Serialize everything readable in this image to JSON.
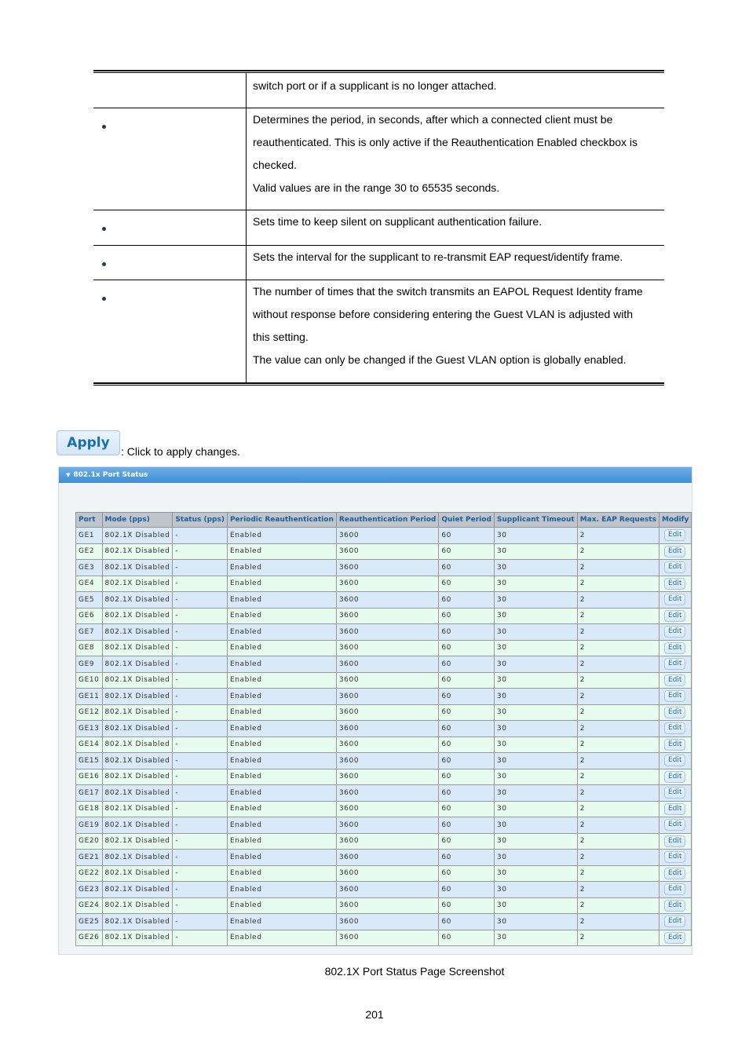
{
  "description_table": {
    "rows": [
      {
        "has_bullet": false,
        "lines": [
          "switch port or if a supplicant is no longer attached."
        ]
      },
      {
        "has_bullet": true,
        "lines": [
          "Determines the period, in seconds, after which a connected client must be",
          "reauthenticated. This is only active if the Reauthentication Enabled checkbox is",
          "checked.",
          "Valid values are in the range 30 to 65535 seconds."
        ]
      },
      {
        "has_bullet": true,
        "lines": [
          "Sets time to keep silent on supplicant authentication failure."
        ]
      },
      {
        "has_bullet": true,
        "lines": [
          "Sets the interval for the supplicant to re-transmit EAP request/identify frame."
        ]
      },
      {
        "has_bullet": true,
        "lines": [
          "The number of times that the switch transmits an EAPOL Request Identity frame",
          "without response before considering entering the Guest VLAN is adjusted with",
          "this setting.",
          "The value can only be changed if the Guest VLAN option is globally enabled."
        ]
      }
    ]
  },
  "apply": {
    "button_label": "Apply",
    "description": ": Click to apply changes."
  },
  "panel": {
    "title": "802.1x Port Status",
    "collapse_icon": "triangle-down-icon",
    "columns": [
      "Port",
      "Mode (pps)",
      "Status (pps)",
      "Periodic Reauthentication",
      "Reauthentication Period",
      "Quiet Period",
      "Supplicant Timeout",
      "Max. EAP Requests",
      "Modify"
    ],
    "edit_label": "Edit",
    "rows": [
      [
        "GE1",
        "802.1X Disabled",
        "-",
        "Enabled",
        "3600",
        "60",
        "30",
        "2"
      ],
      [
        "GE2",
        "802.1X Disabled",
        "-",
        "Enabled",
        "3600",
        "60",
        "30",
        "2"
      ],
      [
        "GE3",
        "802.1X Disabled",
        "-",
        "Enabled",
        "3600",
        "60",
        "30",
        "2"
      ],
      [
        "GE4",
        "802.1X Disabled",
        "-",
        "Enabled",
        "3600",
        "60",
        "30",
        "2"
      ],
      [
        "GE5",
        "802.1X Disabled",
        "-",
        "Enabled",
        "3600",
        "60",
        "30",
        "2"
      ],
      [
        "GE6",
        "802.1X Disabled",
        "-",
        "Enabled",
        "3600",
        "60",
        "30",
        "2"
      ],
      [
        "GE7",
        "802.1X Disabled",
        "-",
        "Enabled",
        "3600",
        "60",
        "30",
        "2"
      ],
      [
        "GE8",
        "802.1X Disabled",
        "-",
        "Enabled",
        "3600",
        "60",
        "30",
        "2"
      ],
      [
        "GE9",
        "802.1X Disabled",
        "-",
        "Enabled",
        "3600",
        "60",
        "30",
        "2"
      ],
      [
        "GE10",
        "802.1X Disabled",
        "-",
        "Enabled",
        "3600",
        "60",
        "30",
        "2"
      ],
      [
        "GE11",
        "802.1X Disabled",
        "-",
        "Enabled",
        "3600",
        "60",
        "30",
        "2"
      ],
      [
        "GE12",
        "802.1X Disabled",
        "-",
        "Enabled",
        "3600",
        "60",
        "30",
        "2"
      ],
      [
        "GE13",
        "802.1X Disabled",
        "-",
        "Enabled",
        "3600",
        "60",
        "30",
        "2"
      ],
      [
        "GE14",
        "802.1X Disabled",
        "-",
        "Enabled",
        "3600",
        "60",
        "30",
        "2"
      ],
      [
        "GE15",
        "802.1X Disabled",
        "-",
        "Enabled",
        "3600",
        "60",
        "30",
        "2"
      ],
      [
        "GE16",
        "802.1X Disabled",
        "-",
        "Enabled",
        "3600",
        "60",
        "30",
        "2"
      ],
      [
        "GE17",
        "802.1X Disabled",
        "-",
        "Enabled",
        "3600",
        "60",
        "30",
        "2"
      ],
      [
        "GE18",
        "802.1X Disabled",
        "-",
        "Enabled",
        "3600",
        "60",
        "30",
        "2"
      ],
      [
        "GE19",
        "802.1X Disabled",
        "-",
        "Enabled",
        "3600",
        "60",
        "30",
        "2"
      ],
      [
        "GE20",
        "802.1X Disabled",
        "-",
        "Enabled",
        "3600",
        "60",
        "30",
        "2"
      ],
      [
        "GE21",
        "802.1X Disabled",
        "-",
        "Enabled",
        "3600",
        "60",
        "30",
        "2"
      ],
      [
        "GE22",
        "802.1X Disabled",
        "-",
        "Enabled",
        "3600",
        "60",
        "30",
        "2"
      ],
      [
        "GE23",
        "802.1X Disabled",
        "-",
        "Enabled",
        "3600",
        "60",
        "30",
        "2"
      ],
      [
        "GE24",
        "802.1X Disabled",
        "-",
        "Enabled",
        "3600",
        "60",
        "30",
        "2"
      ],
      [
        "GE25",
        "802.1X Disabled",
        "-",
        "Enabled",
        "3600",
        "60",
        "30",
        "2"
      ],
      [
        "GE26",
        "802.1X Disabled",
        "-",
        "Enabled",
        "3600",
        "60",
        "30",
        "2"
      ]
    ]
  },
  "caption": "802.1X Port Status Page Screenshot",
  "page_number": "201",
  "colors": {
    "header_blue": "#3d8fd8",
    "row_odd": "#d9e9f8",
    "row_even": "#e8fbef",
    "th_text": "#1b5e9c",
    "button_text": "#1a6fb0"
  }
}
